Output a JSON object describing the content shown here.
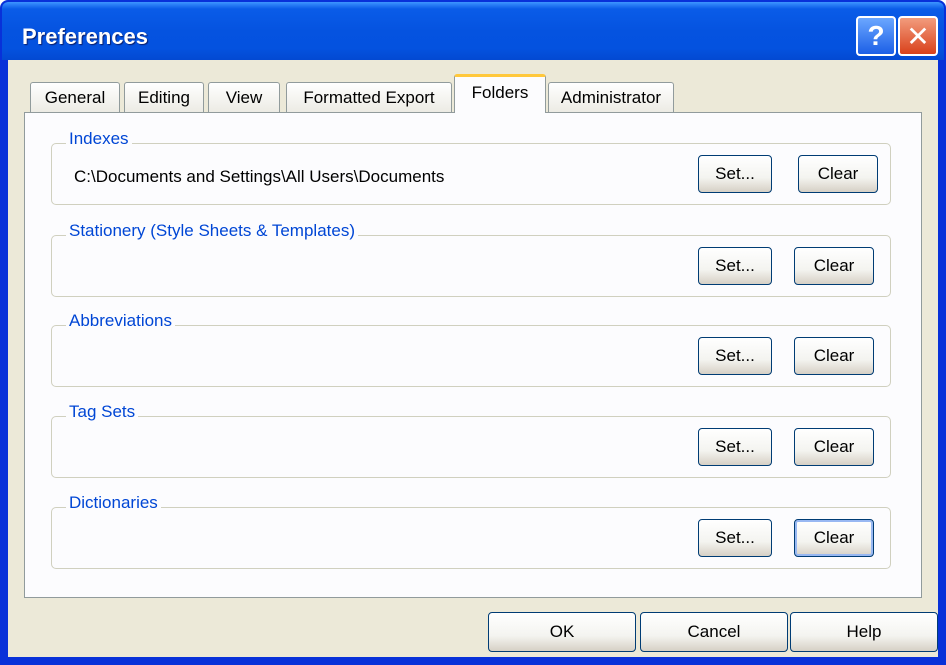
{
  "window": {
    "title": "Preferences",
    "help_glyph": "?",
    "close_glyph": "✕"
  },
  "tabs": [
    {
      "label": "General",
      "active": false
    },
    {
      "label": "Editing",
      "active": false
    },
    {
      "label": "View",
      "active": false
    },
    {
      "label": "Formatted Export",
      "active": false
    },
    {
      "label": "Folders",
      "active": true
    },
    {
      "label": "Administrator",
      "active": false
    }
  ],
  "groups": [
    {
      "label": "Indexes",
      "path": "C:\\Documents and Settings\\All Users\\Documents",
      "set_label": "Set...",
      "clear_label": "Clear"
    },
    {
      "label": "Stationery (Style Sheets & Templates)",
      "path": "",
      "set_label": "Set...",
      "clear_label": "Clear"
    },
    {
      "label": "Abbreviations",
      "path": "",
      "set_label": "Set...",
      "clear_label": "Clear"
    },
    {
      "label": "Tag Sets",
      "path": "",
      "set_label": "Set...",
      "clear_label": "Clear"
    },
    {
      "label": "Dictionaries",
      "path": "",
      "set_label": "Set...",
      "clear_label": "Clear"
    }
  ],
  "buttons": {
    "ok": "OK",
    "cancel": "Cancel",
    "help": "Help"
  },
  "colors": {
    "title_bar": "#0553e0",
    "group_label": "#0046d5",
    "dialog_face": "#ece9d8",
    "active_tab_highlight": "#ffc83c"
  }
}
